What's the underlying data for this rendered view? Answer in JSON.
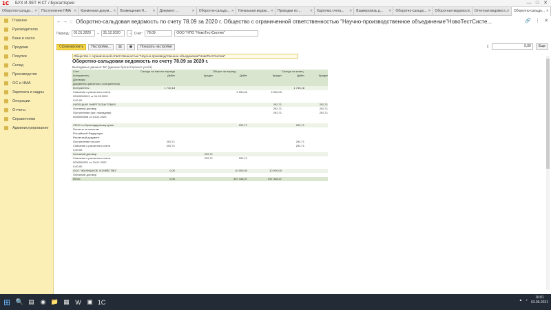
{
  "app": {
    "logo": "1C",
    "title": "БУХ И ЛЕТ Н СТ / Бухгалтерия"
  },
  "window_controls": [
    "—",
    "□",
    "✕"
  ],
  "tabs": [
    "Оборотно-сальдо...",
    "Поступление НМА",
    "Кременная докум...",
    "Возмещения Н...",
    "Документ ...",
    "Оборотно-сальдо...",
    "Начальная ведом...",
    "Проводки по ...",
    "Карточка счета...",
    "Взаимосвязь д...",
    "Оборотно-сальдо...",
    "Оборотная ведомост...",
    "Отчетная ведомост...",
    "Оборотно-сальдо..."
  ],
  "sidebar": [
    "Главное",
    "Руководителю",
    "Банк и касса",
    "Продажи",
    "Покупки",
    "Склад",
    "Производство",
    "ОС и НМА",
    "Зарплата и кадры",
    "Операции",
    "Отчеты",
    "Справочники",
    "Администрирование"
  ],
  "header": {
    "title": "Оборотно-сальдовая ведомость по счету 78.09 за 2020 г. Общество с ограниченной ответственностью \"Научно-производственное объединение\"НовоТестСисте..."
  },
  "params": {
    "period_label": "Период:",
    "date_from": "01.01.2020",
    "dash": "–",
    "date_to": "31.12.2020",
    "account_label": "Счет:",
    "account": "78.09",
    "org": "ООО \"НПО \"НовоТестСистем\""
  },
  "toolbar": {
    "generate": "Сформировать",
    "settings": "Настройки...",
    "show_settings": "Показать настройки",
    "sum_label": "Σ",
    "sum_value": "0,00",
    "more": "Еще"
  },
  "report": {
    "org": "Общество с ограниченной ответственностью \"Научно-производственное объединение\"НовоТестСистем\"",
    "title": "Оборотно-сальдовая ведомость по счету 78.09 за 2020 г.",
    "subtitle": "Выводимые данные: БУ (данные бухгалтерского учета)",
    "headers": [
      "Счет",
      "Сальдо на начало периода",
      "Оборот за период",
      "Сальдо на конец периода"
    ],
    "subheaders": [
      "Контрагенты",
      "Договоры",
      "Документы расчетов с контрагентом",
      "Дебет",
      "Кредит",
      "Дебет",
      "Кредит",
      "Дебет",
      "Кредит"
    ],
    "rows": [
      {
        "cols": [
          "Контрагенты",
          "1 740,18",
          "",
          "",
          "",
          "1 740,18",
          ""
        ],
        "type": "group"
      },
      {
        "cols": [
          "  Списание с расчетного счета",
          "",
          "",
          "2 000,00",
          "2 000,00",
          "",
          ""
        ]
      },
      {
        "cols": [
          "  00000000012 от 04.03.2020",
          "",
          "",
          "",
          "",
          "",
          ""
        ]
      },
      {
        "cols": [
          "  0,00,00",
          "",
          "",
          "",
          "",
          "",
          ""
        ]
      },
      {
        "cols": [
          "ЛИПЕЦКАЯ ЭНЕРГОСБЫТОВАЯ",
          "",
          "",
          "",
          "292,71",
          "",
          "292,71"
        ],
        "type": "group"
      },
      {
        "cols": [
          "Основной договор",
          "",
          "",
          "",
          "292,71",
          "",
          "292,71"
        ]
      },
      {
        "cols": [
          "  Поступление (акт, накладная)",
          "",
          "",
          "",
          "292,71",
          "",
          "292,71"
        ]
      },
      {
        "cols": [
          "  0000000008 от 24.01.2020",
          "",
          "",
          "",
          "",
          "",
          ""
        ]
      },
      {
        "cols": [
          "",
          "",
          "",
          "",
          "",
          "",
          ""
        ]
      },
      {
        "cols": [
          "УФНС по Краснодарскому краю",
          "",
          "",
          "292,71",
          "",
          "292,71",
          ""
        ],
        "type": "group"
      },
      {
        "cols": [
          "  Расчеты по налогам",
          "",
          "",
          "",
          "",
          "",
          ""
        ]
      },
      {
        "cols": [
          "  Российской Федерации",
          "",
          "",
          "",
          "",
          "",
          ""
        ]
      },
      {
        "cols": [
          "  Расчетный документ",
          "",
          "",
          "",
          "",
          "",
          ""
        ]
      },
      {
        "cols": [
          "  Поступление на счет",
          "292,71",
          "",
          "",
          "",
          "292,71",
          ""
        ]
      },
      {
        "cols": [
          "  Списание с расчетного счета",
          "292,71",
          "",
          "",
          "",
          "292,71",
          ""
        ]
      },
      {
        "cols": [
          "  0,00,00",
          "",
          "",
          "",
          "",
          "",
          ""
        ]
      },
      {
        "cols": [
          "  Основной договор",
          "",
          "292,71",
          "",
          "",
          "",
          ""
        ],
        "type": "group"
      },
      {
        "cols": [
          "  Списание с расчетного счета",
          "",
          "292,71",
          "292,71",
          "",
          "",
          ""
        ]
      },
      {
        "cols": [
          "  0000000001 от 24.01.2020",
          "",
          "",
          "",
          "",
          "",
          ""
        ]
      },
      {
        "cols": [
          "  0,00,00",
          "",
          "",
          "",
          "",
          "",
          ""
        ]
      },
      {
        "cols": [
          "ООО \"ЖИЛИЩНОЕ ХОЗЯЙСТВО\"",
          "0,00",
          "",
          "10 000,00",
          "10 000,00",
          "",
          ""
        ],
        "type": "group"
      },
      {
        "cols": [
          "  Основной договор",
          "",
          "",
          "",
          "",
          "",
          ""
        ]
      },
      {
        "cols": [
          "Итого",
          "0,00",
          "",
          "337 446,37",
          "337 446,37",
          "",
          ""
        ],
        "type": "total"
      }
    ]
  },
  "taskbar": {
    "apps": [
      "⊞",
      "🔍",
      "▤",
      "◉",
      "📁",
      "▦",
      "W",
      "▣",
      "1C"
    ],
    "time": "16:01",
    "date": "03.06.2021"
  }
}
